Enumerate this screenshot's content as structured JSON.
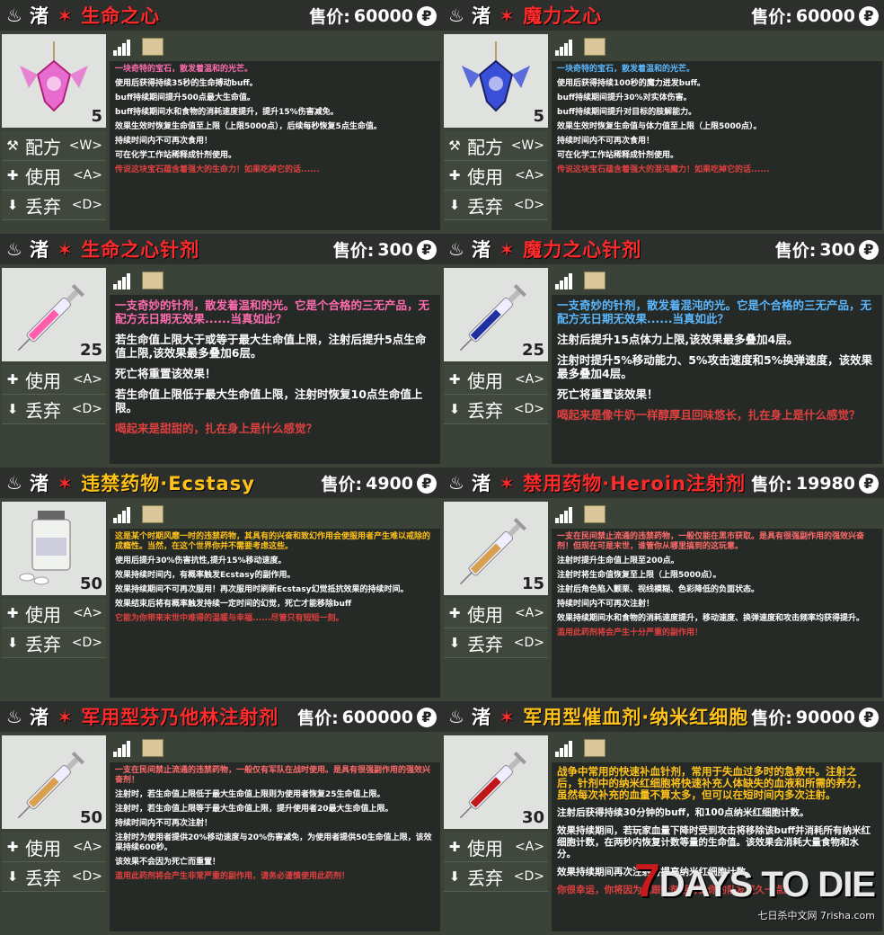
{
  "currency_icon": "ruble-coin-icon",
  "prefix_text": "渚",
  "star": "✶",
  "cards": [
    {
      "id": "life-heart",
      "name": "生命之心",
      "name_color": "#ff2a2a",
      "price_label": "售价:",
      "price": "60000",
      "count": "5",
      "icon": "pink-gem-icon",
      "actions": [
        {
          "icon": "hammer-icon",
          "label": "配方",
          "key": "<W>"
        },
        {
          "icon": "medkit-icon",
          "label": "使用",
          "key": "<A>"
        },
        {
          "icon": "down-arrow-icon",
          "label": "丢弃",
          "key": "<D>"
        }
      ],
      "flavor": "一块奇特的宝石，散发着温和的光芒。",
      "flavor_color": "#ff6bb0",
      "lines": [
        "使用后获得持续35秒的生命搏动buff。",
        "buff持续期间提升500点最大生命值。",
        "buff持续期间水和食物的消耗速度提升，提升15%伤害减免。",
        "效果生效时恢复生命值至上限（上限5000点），后续每秒恢复5点生命值。",
        "持续时间内不可再次食用！",
        "可在化学工作站稀释成针剂使用。"
      ],
      "lore": "传说这块宝石蕴含着强大的生命力！如果吃掉它的话......"
    },
    {
      "id": "mana-heart",
      "name": "魔力之心",
      "name_color": "#ff2a2a",
      "price_label": "售价:",
      "price": "60000",
      "count": "5",
      "icon": "blue-gem-icon",
      "actions": [
        {
          "icon": "hammer-icon",
          "label": "配方",
          "key": "<W>"
        },
        {
          "icon": "medkit-icon",
          "label": "使用",
          "key": "<A>"
        },
        {
          "icon": "down-arrow-icon",
          "label": "丢弃",
          "key": "<D>"
        }
      ],
      "flavor": "一块奇特的宝石，散发着温和的光芒。",
      "flavor_color": "#5bb8ff",
      "lines": [
        "使用后获得持续100秒的魔力迸发buff。",
        "buff持续期间提升30%对实体伤害。",
        "buff持续期间提升对目标的肢解能力。",
        "效果生效时恢复生命值与体力值至上限（上限5000点）。",
        "持续时间内不可再次食用！",
        "可在化学工作站稀释成针剂使用。"
      ],
      "lore": "传说这块宝石蕴含着强大的混沌魔力！如果吃掉它的话......"
    },
    {
      "id": "life-heart-injection",
      "name": "生命之心针剂",
      "name_color": "#ff2a2a",
      "price_label": "售价:",
      "price": "300",
      "count": "25",
      "icon": "pink-syringe-icon",
      "actions": [
        {
          "icon": "medkit-icon",
          "label": "使用",
          "key": "<A>"
        },
        {
          "icon": "down-arrow-icon",
          "label": "丢弃",
          "key": "<D>"
        }
      ],
      "flavor": "一支奇妙的针剂，散发着温和的光。它是个合格的三无产品，无配方无日期无效果......当真如此？",
      "flavor_color": "#ff6bb0",
      "lines": [
        "若生命值上限大于或等于最大生命值上限，注射后提升5点生命值上限,该效果最多叠加6层。",
        "死亡将重置该效果！",
        "若生命值上限低于最大生命值上限，注射时恢复10点生命值上限。"
      ],
      "lore": "喝起来是甜甜的，扎在身上是什么感觉？"
    },
    {
      "id": "mana-heart-injection",
      "name": "魔力之心针剂",
      "name_color": "#ff2a2a",
      "price_label": "售价:",
      "price": "300",
      "count": "25",
      "icon": "blue-syringe-icon",
      "actions": [
        {
          "icon": "medkit-icon",
          "label": "使用",
          "key": "<A>"
        },
        {
          "icon": "down-arrow-icon",
          "label": "丢弃",
          "key": "<D>"
        }
      ],
      "flavor": "一支奇妙的针剂，散发着混沌的光。它是个合格的三无产品，无配方无日期无效果......当真如此？",
      "flavor_color": "#5bb8ff",
      "lines": [
        "注射后提升15点体力上限,该效果最多叠加4层。",
        "注射时提升5%移动能力、5%攻击速度和5%换弹速度，该效果最多叠加4层。",
        "死亡将重置该效果！"
      ],
      "lore": "喝起来是像牛奶一样醇厚且回味悠长，扎在身上是什么感觉？"
    },
    {
      "id": "ecstasy",
      "name": "违禁药物·Ecstasy",
      "name_color": "#ffc21a",
      "price_label": "售价:",
      "price": "4900",
      "count": "50",
      "icon": "pill-bottle-icon",
      "actions": [
        {
          "icon": "medkit-icon",
          "label": "使用",
          "key": "<A>"
        },
        {
          "icon": "down-arrow-icon",
          "label": "丢弃",
          "key": "<D>"
        }
      ],
      "flavor": "这是某个时期风靡一时的违禁药物，其具有的兴奋和致幻作用会使服用者产生难以戒除的成瘾性。当然，在这个世界你并不需要考虑这些。",
      "flavor_color": "#ffc21a",
      "lines": [
        "使用后提升30%伤害抗性,提升15%移动速度。",
        "效果持续时间内，有概率触发Ecstasy的副作用。",
        "效果持续期间不可再次服用！再次服用时刷新Ecstasy幻觉抵抗效果的持续时间。",
        "效果结束后将有概率触发持续一定时间的幻觉，死亡才能移除buff"
      ],
      "lore": "它能为你带来末世中难得的温暖与幸福......尽管只有短短一刻。"
    },
    {
      "id": "heroin",
      "name": "禁用药物·Heroin注射剂",
      "name_color": "#ff2a2a",
      "price_label": "售价:",
      "price": "19980",
      "count": "15",
      "icon": "syringe-icon",
      "actions": [
        {
          "icon": "medkit-icon",
          "label": "使用",
          "key": "<A>"
        },
        {
          "icon": "down-arrow-icon",
          "label": "丢弃",
          "key": "<D>"
        }
      ],
      "flavor": "一支在民间禁止流通的违禁药物，一般仅能在黑市获取。是具有很强副作用的强效兴奋剂！但现在可是末世，谁管你从哪里搞到的这玩意。",
      "flavor_color": "#ff6b6b",
      "lines": [
        "注射时提升生命值上限至200点。",
        "注射时将生命值恢复至上限（上限5000点）。",
        "注射后角色陷入颤栗、视线模糊、色彩降低的负面状态。",
        "持续时间内不可再次注射！",
        "效果持续期间水和食物的消耗速度提升，移动速度、换弹速度和攻击频率均获得提升。"
      ],
      "lore": "滥用此药剂将会产生十分严重的副作用！"
    },
    {
      "id": "fentanyl",
      "name": "军用型芬乃他林注射剂",
      "name_color": "#ff2a2a",
      "price_label": "售价:",
      "price": "600000",
      "count": "50",
      "icon": "syringe-icon",
      "actions": [
        {
          "icon": "medkit-icon",
          "label": "使用",
          "key": "<A>"
        },
        {
          "icon": "down-arrow-icon",
          "label": "丢弃",
          "key": "<D>"
        }
      ],
      "flavor": "一支在民间禁止流通的违禁药物，一般仅有军队在战时使用。是具有很强副作用的强效兴奋剂！",
      "flavor_color": "#ff6b6b",
      "lines": [
        "注射时，若生命值上限低于最大生命值上限则为使用者恢复25生命值上限。",
        "注射时，若生命值上限等于最大生命值上限，提升使用者20最大生命值上限。",
        "持续时间内不可再次注射！",
        "注射时为使用者提供20%移动速度与20%伤害减免，为使用者提供50生命值上限，该效果持续600秒。",
        "该效果不会因为死亡而重置！"
      ],
      "lore": "滥用此药剂将会产生非常严重的副作用，请务必谨慎使用此药剂！"
    },
    {
      "id": "nano-rbc",
      "name": "军用型催血剂·纳米红细胞",
      "name_color": "#ffc21a",
      "price_label": "售价:",
      "price": "90000",
      "count": "30",
      "icon": "red-syringe-icon",
      "actions": [
        {
          "icon": "medkit-icon",
          "label": "使用",
          "key": "<A>"
        },
        {
          "icon": "down-arrow-icon",
          "label": "丢弃",
          "key": "<D>"
        }
      ],
      "flavor": "战争中常用的快速补血针剂，常用于失血过多时的急救中。注射之后，针剂中的纳米红细胞将快速补充人体缺失的血液和所需的养分，虽然每次补充的血量不算太多，但可以在短时间内多次注射。",
      "flavor_color": "#ffc21a",
      "lines": [
        "注射后获得持续30分钟的buff，和100点纳米红细胞计数。",
        "效果持续期间，若玩家血量下降时受到攻击将移除该buff并消耗所有纳米红细胞计数，在两秒内恢复计数等量的生命值。该效果会消耗大量食物和水分。",
        "效果持续期间再次注射将提高纳米红细胞计数。"
      ],
      "lore": "你很幸运，你将因为这跟针剂活得比你的队友更久一点。"
    }
  ],
  "watermark": {
    "title_seven": "7",
    "title_rest": "DAYS TO DIE",
    "subtitle": "七日杀中文网 7risha.com"
  }
}
